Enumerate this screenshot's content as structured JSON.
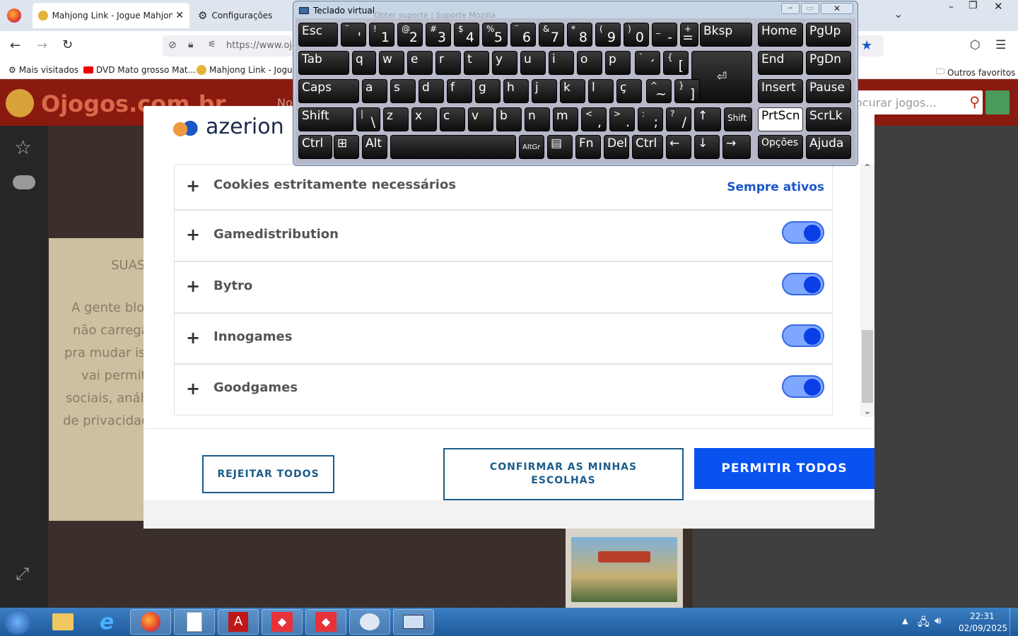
{
  "browser": {
    "tabs": [
      {
        "label": "Mahjong Link - Jogue Mahjong",
        "active": true
      },
      {
        "label": "Configurações",
        "active": false
      }
    ],
    "url_text": "https://www.ojo",
    "bookmarks": [
      "Mais visitados",
      "DVD Mato grosso Mat...",
      "Mahjong Link - Jogue",
      "Outros favoritos"
    ]
  },
  "site": {
    "logo_text": "Ojogos.com.br",
    "nav_partial": "No",
    "search_placeholder": "ocurar jogos...",
    "panel_lines": [
      "SUAS",
      "A gente bloc",
      "não carrega",
      "pra mudar iss",
      "vai permiti",
      "sociais, anális",
      "de privacidade"
    ]
  },
  "modal": {
    "brand": "azerion",
    "rows": [
      {
        "label": "Cookies estritamente necessários",
        "status": "Sempre ativos"
      },
      {
        "label": "Gamedistribution",
        "toggle_on": true
      },
      {
        "label": "Bytro",
        "toggle_on": true
      },
      {
        "label": "Innogames",
        "toggle_on": true
      },
      {
        "label": "Goodgames",
        "toggle_on": true
      }
    ],
    "buttons": {
      "reject": "REJEITAR TODOS",
      "confirm": "CONFIRMAR AS MINHAS ESCOLHAS",
      "allow": "PERMITIR TODOS"
    },
    "colors": {
      "accent": "#0a52f0",
      "link": "#1a56c8",
      "toggle_track": "#7fa7ff",
      "toggle_knob": "#0a3fe8"
    }
  },
  "keyboard": {
    "title": "Teclado virtual",
    "bg_window_text": "Obter suporte | Suporte Mozilla",
    "rows": [
      [
        {
          "t": "Esc"
        },
        {
          "u": "¨",
          "b": "'"
        },
        {
          "u": "!",
          "b": "1"
        },
        {
          "u": "@",
          "b": "2"
        },
        {
          "u": "#",
          "b": "3"
        },
        {
          "u": "$",
          "b": "4"
        },
        {
          "u": "%",
          "b": "5"
        },
        {
          "u": "¨",
          "b": "6"
        },
        {
          "u": "&",
          "b": "7"
        },
        {
          "u": "*",
          "b": "8"
        },
        {
          "u": "(",
          "b": "9"
        },
        {
          "u": ")",
          "b": "0"
        },
        {
          "u": "_",
          "b": "-"
        },
        {
          "u": "+",
          "b": "="
        },
        {
          "t": "Bksp"
        },
        {
          "t": "Home"
        },
        {
          "t": "PgUp"
        }
      ],
      [
        {
          "t": "Tab"
        },
        {
          "t": "q"
        },
        {
          "t": "w"
        },
        {
          "t": "e"
        },
        {
          "t": "r"
        },
        {
          "t": "t"
        },
        {
          "t": "y"
        },
        {
          "t": "u"
        },
        {
          "t": "i"
        },
        {
          "t": "o"
        },
        {
          "t": "p"
        },
        {
          "u": "`",
          "b": "´"
        },
        {
          "u": "{",
          "b": "["
        },
        {
          "t": "⏎"
        },
        {
          "t": "End"
        },
        {
          "t": "PgDn"
        }
      ],
      [
        {
          "t": "Caps"
        },
        {
          "t": "a"
        },
        {
          "t": "s"
        },
        {
          "t": "d"
        },
        {
          "t": "f"
        },
        {
          "t": "g"
        },
        {
          "t": "h"
        },
        {
          "t": "j"
        },
        {
          "t": "k"
        },
        {
          "t": "l"
        },
        {
          "t": "ç"
        },
        {
          "u": "^",
          "b": "~"
        },
        {
          "u": "}",
          "b": "]"
        },
        {
          "t": "Insert"
        },
        {
          "t": "Pause"
        }
      ],
      [
        {
          "t": "Shift"
        },
        {
          "u": "|",
          "b": "\\"
        },
        {
          "t": "z"
        },
        {
          "t": "x"
        },
        {
          "t": "c"
        },
        {
          "t": "v"
        },
        {
          "t": "b"
        },
        {
          "t": "n"
        },
        {
          "t": "m"
        },
        {
          "u": "<",
          "b": ","
        },
        {
          "u": ">",
          "b": "."
        },
        {
          "u": ":",
          "b": ";"
        },
        {
          "u": "?",
          "b": "/"
        },
        {
          "t": "↑"
        },
        {
          "t": "Shift"
        },
        {
          "t": "PrtScn"
        },
        {
          "t": "ScrLk"
        }
      ],
      [
        {
          "t": "Ctrl"
        },
        {
          "t": "⊞"
        },
        {
          "t": "Alt"
        },
        {
          "t": ""
        },
        {
          "t": "AltGr"
        },
        {
          "t": "▤"
        },
        {
          "t": "Fn"
        },
        {
          "t": "Del"
        },
        {
          "t": "Ctrl"
        },
        {
          "t": "←"
        },
        {
          "t": "↓"
        },
        {
          "t": "→"
        },
        {
          "t": "Opções"
        },
        {
          "t": "Ajuda"
        }
      ]
    ]
  },
  "taskbar": {
    "time": "22:31",
    "date": "02/09/2025"
  }
}
